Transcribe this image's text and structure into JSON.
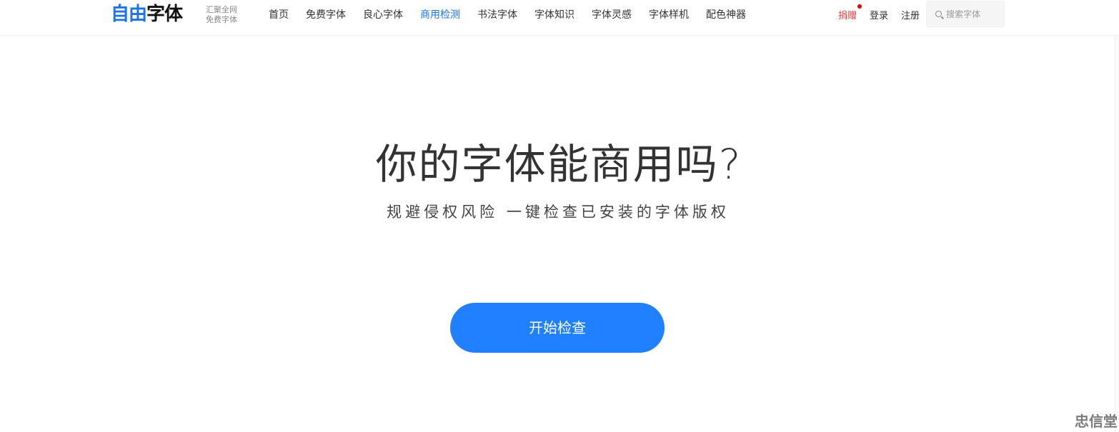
{
  "header": {
    "logo_blue": "自由",
    "logo_black": "字体",
    "logo_sub_line1": "汇聚全网",
    "logo_sub_line2": "免费字体",
    "nav": [
      {
        "label": "首页",
        "active": false
      },
      {
        "label": "免费字体",
        "active": false
      },
      {
        "label": "良心字体",
        "active": false
      },
      {
        "label": "商用检测",
        "active": true
      },
      {
        "label": "书法字体",
        "active": false
      },
      {
        "label": "字体知识",
        "active": false
      },
      {
        "label": "字体灵感",
        "active": false
      },
      {
        "label": "字体样机",
        "active": false
      },
      {
        "label": "配色神器",
        "active": false
      }
    ],
    "donate": "捐赠",
    "login": "登录",
    "register": "注册",
    "search_placeholder": "搜索字体"
  },
  "hero": {
    "title": "你的字体能商用吗?",
    "subtitle": "规避侵权风险 一键检查已安装的字体版权",
    "button": "开始检查"
  },
  "watermark": "忠信堂",
  "colors": {
    "accent": "#1a73e8",
    "button": "#2080ff",
    "donate": "#e03b3b"
  }
}
